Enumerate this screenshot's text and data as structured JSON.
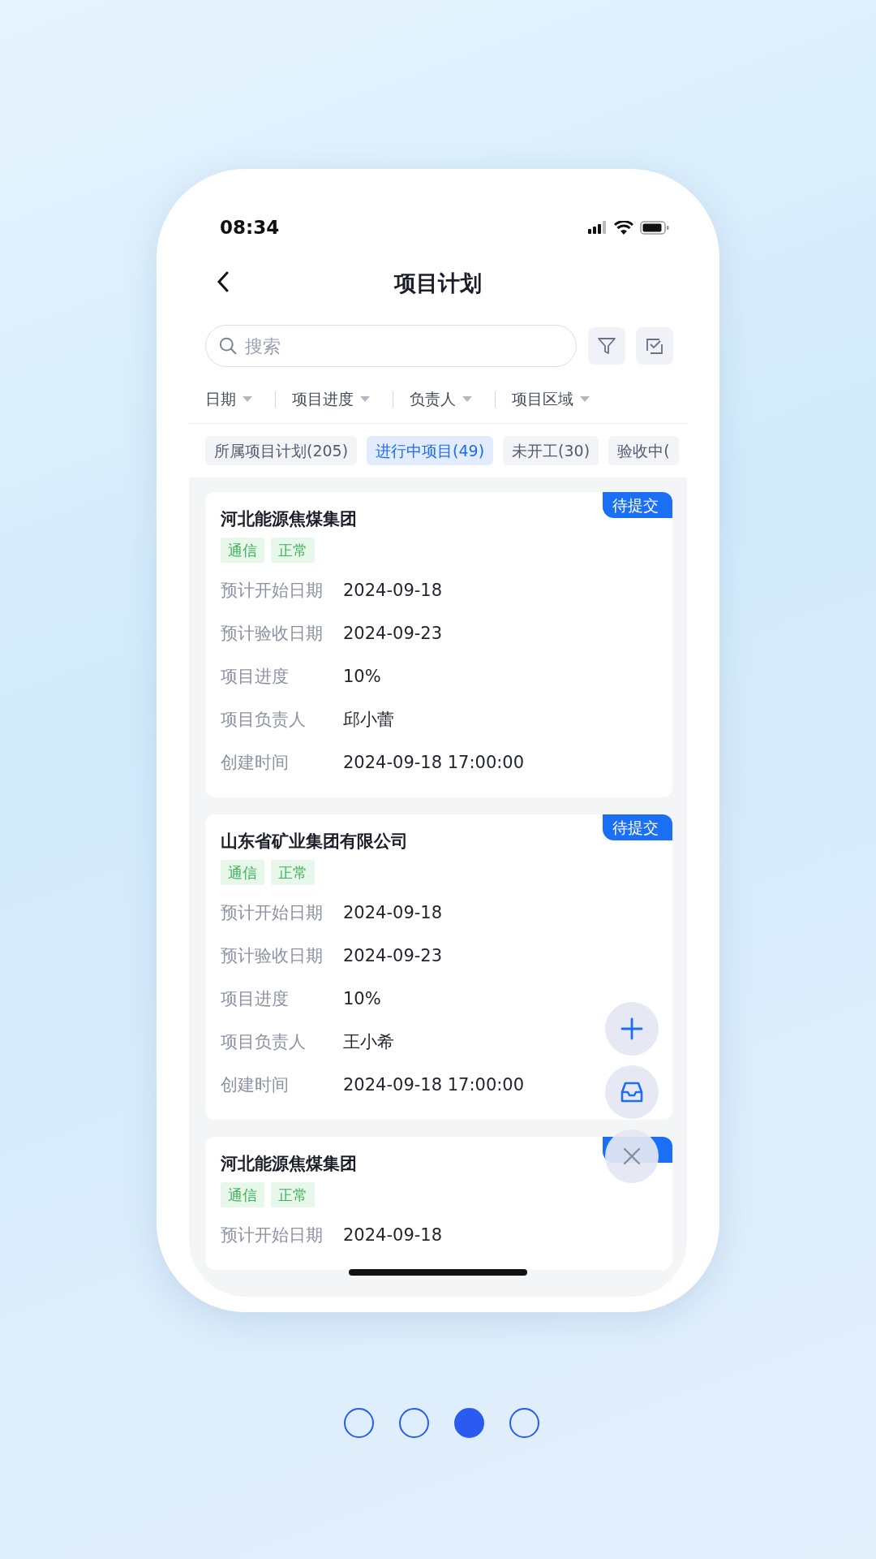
{
  "status_bar": {
    "time": "08:34"
  },
  "header": {
    "title": "项目计划"
  },
  "search": {
    "placeholder": "搜索"
  },
  "filters": [
    {
      "label": "日期"
    },
    {
      "label": "项目进度"
    },
    {
      "label": "负责人"
    },
    {
      "label": "项目区域"
    }
  ],
  "tabs": [
    {
      "label": "所属项目计划(205)",
      "selected": false
    },
    {
      "label": "进行中项目(49)",
      "selected": true
    },
    {
      "label": "未开工(30)",
      "selected": false
    },
    {
      "label": "验收中(",
      "selected": false
    }
  ],
  "projects": [
    {
      "name": "河北能源焦煤集团",
      "tags": [
        "通信",
        "正常"
      ],
      "badge_visible": true,
      "status": "待提交",
      "fields": [
        {
          "label": "预计开始日期",
          "value": "2024-09-18"
        },
        {
          "label": "预计验收日期",
          "value": "2024-09-23"
        },
        {
          "label": "项目进度",
          "value": "10%"
        },
        {
          "label": "项目负责人",
          "value": "邱小蕾"
        },
        {
          "label": "创建时间",
          "value": "2024-09-18 17:00:00"
        }
      ]
    },
    {
      "name": "山东省矿业集团有限公司",
      "tags": [
        "通信",
        "正常"
      ],
      "badge_visible": true,
      "status": "待提交",
      "fields": [
        {
          "label": "预计开始日期",
          "value": "2024-09-18"
        },
        {
          "label": "预计验收日期",
          "value": "2024-09-23"
        },
        {
          "label": "项目进度",
          "value": "10%"
        },
        {
          "label": "项目负责人",
          "value": "王小希"
        },
        {
          "label": "创建时间",
          "value": "2024-09-18 17:00:00"
        }
      ]
    },
    {
      "name": "河北能源焦煤集团",
      "tags": [
        "通信",
        "正常"
      ],
      "badge_visible": true,
      "fields": [
        {
          "label": "预计开始日期",
          "value": "2024-09-18"
        }
      ]
    }
  ],
  "pager": [
    {
      "selected": false
    },
    {
      "selected": false
    },
    {
      "selected": true
    },
    {
      "selected": false
    }
  ]
}
